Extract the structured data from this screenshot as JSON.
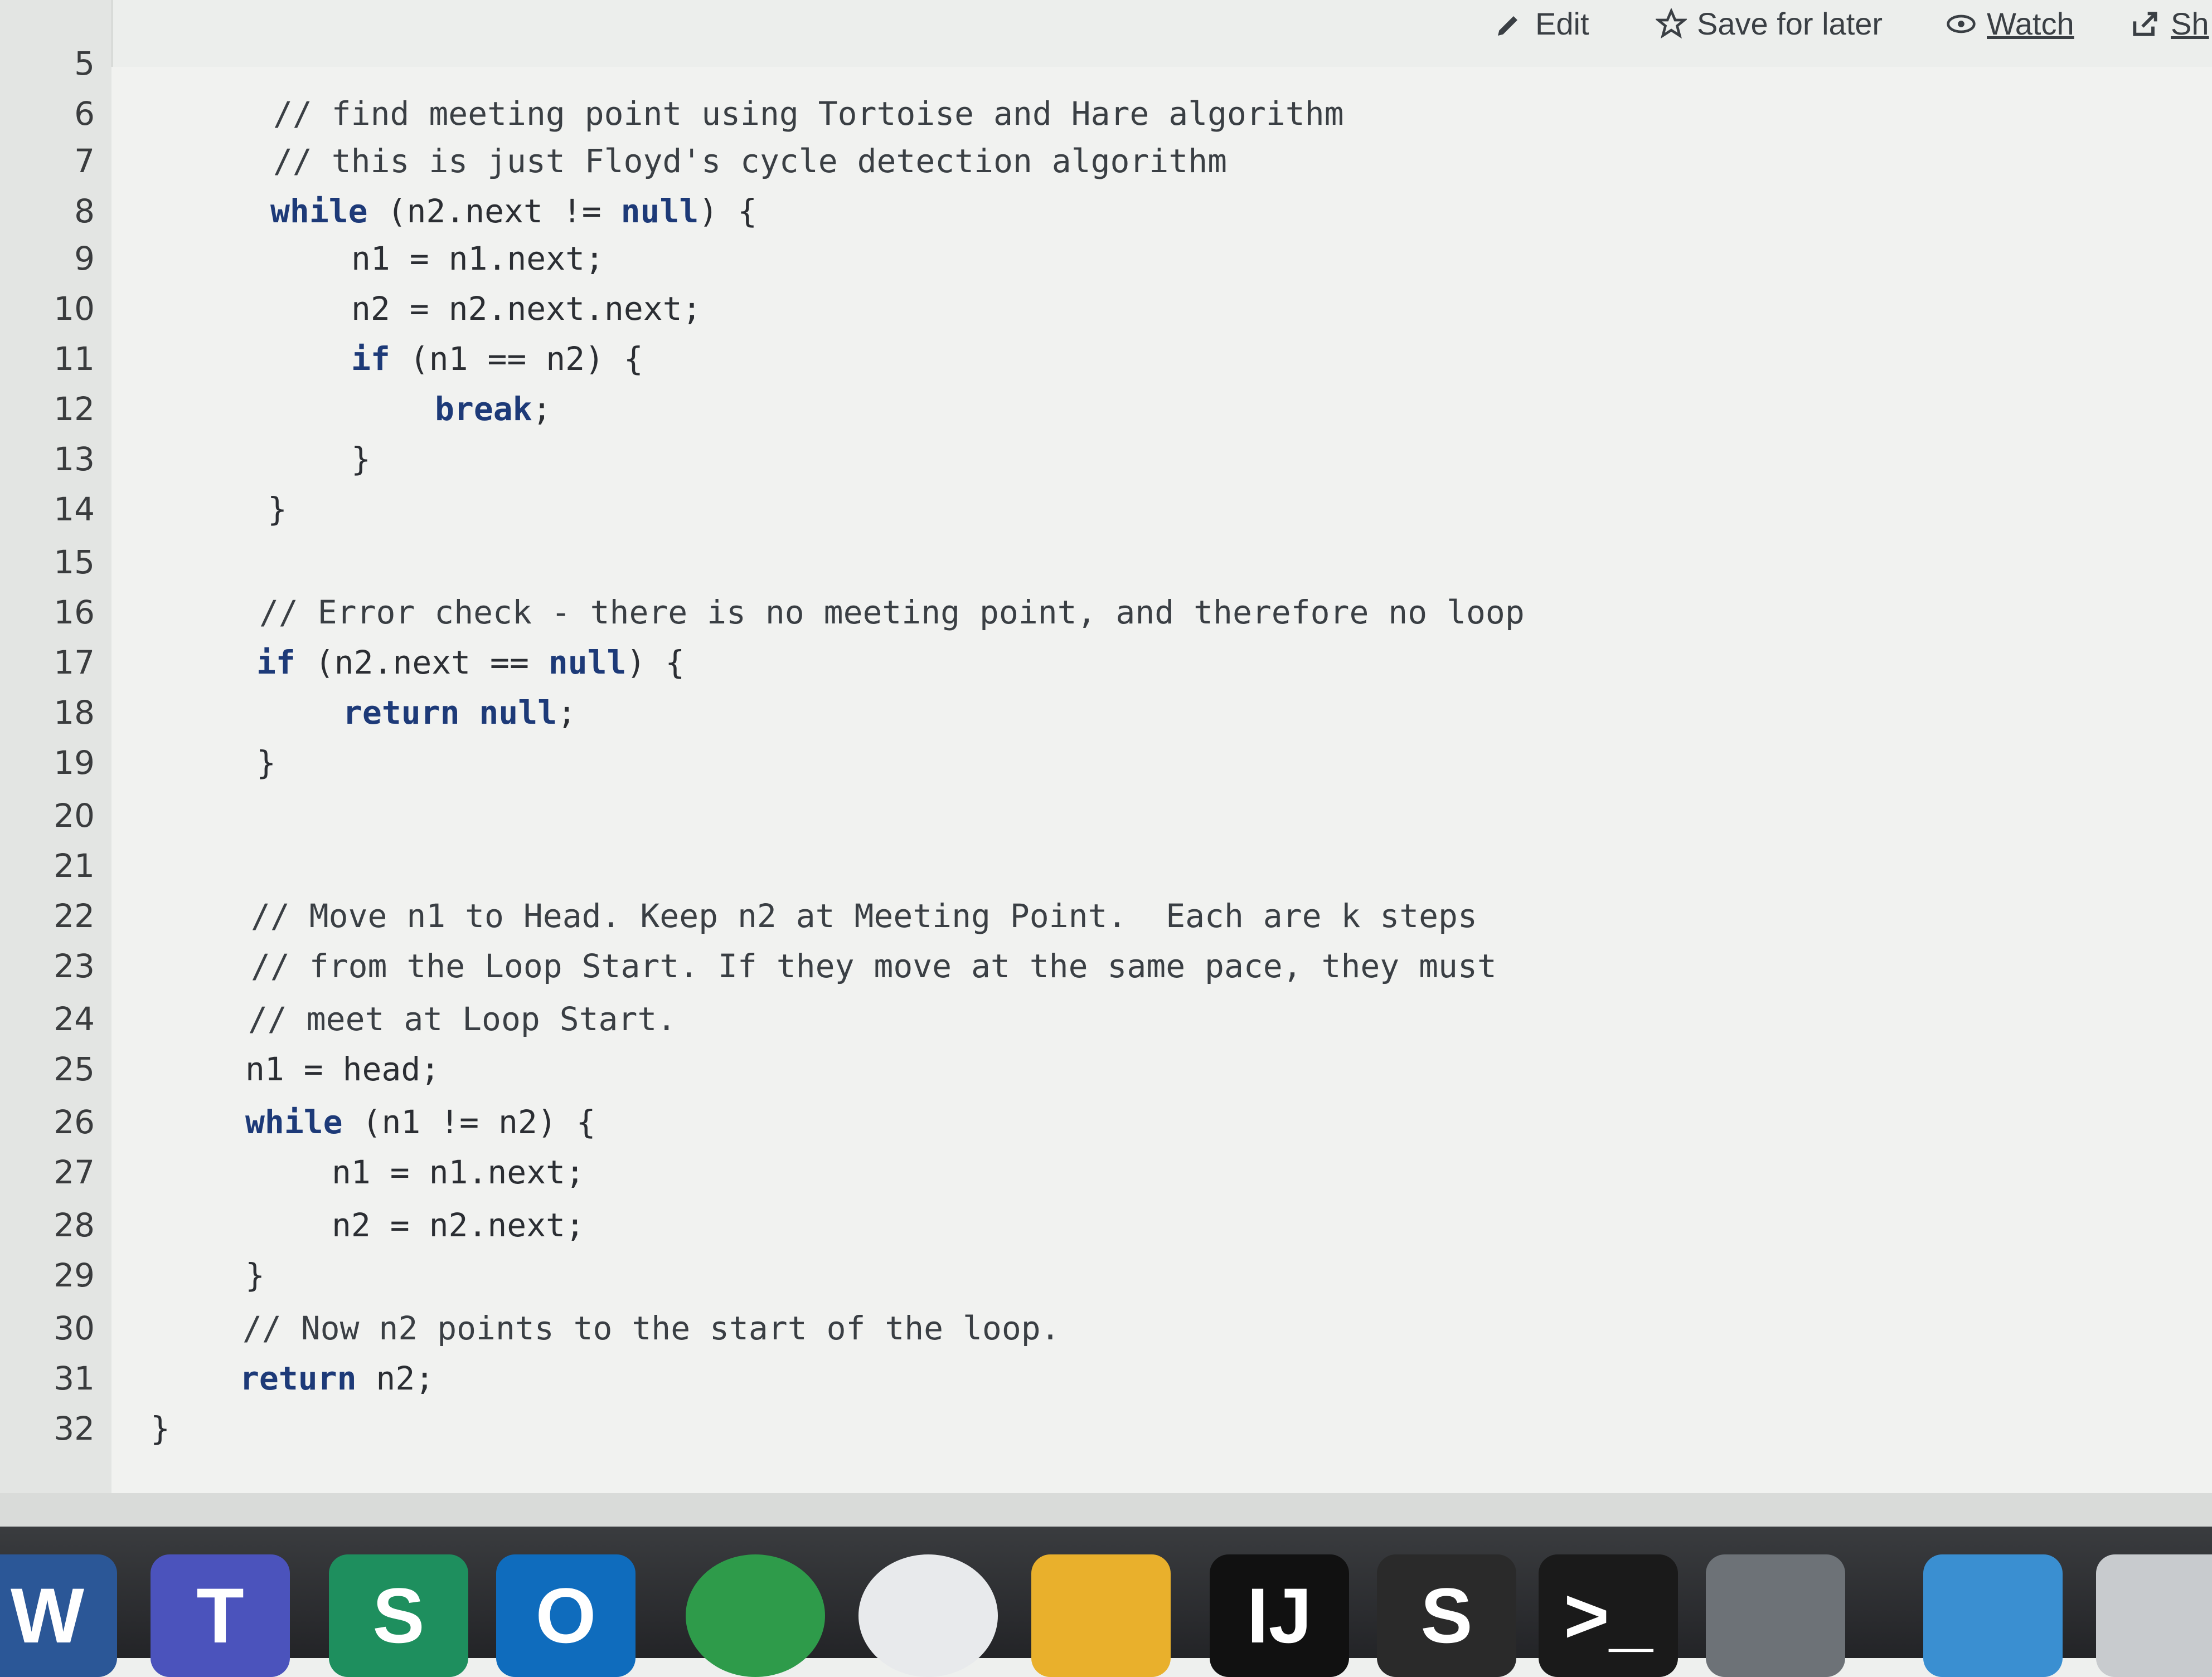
{
  "toolbar": {
    "edit_label": "Edit",
    "save_label": "Save for later",
    "watch_label": "Watch",
    "share_label": "Sh"
  },
  "code": {
    "lines": [
      {
        "n": "5",
        "segments": [
          {
            "t": "",
            "c": "plain"
          }
        ]
      },
      {
        "n": "6",
        "segments": [
          {
            "t": "// find meeting point using Tortoise and Hare algorithm",
            "c": "cm"
          }
        ]
      },
      {
        "n": "7",
        "segments": [
          {
            "t": "// this is just Floyd's cycle detection algorithm",
            "c": "cm"
          }
        ]
      },
      {
        "n": "8",
        "segments": [
          {
            "t": "while",
            "c": "kw"
          },
          {
            "t": " (n2.next != ",
            "c": "plain"
          },
          {
            "t": "null",
            "c": "kw"
          },
          {
            "t": ") {",
            "c": "plain"
          }
        ]
      },
      {
        "n": "9",
        "segments": [
          {
            "t": "n1 = n1.next;",
            "c": "plain"
          }
        ]
      },
      {
        "n": "10",
        "segments": [
          {
            "t": "n2 = n2.next.next;",
            "c": "plain"
          }
        ]
      },
      {
        "n": "11",
        "segments": [
          {
            "t": "if",
            "c": "kw"
          },
          {
            "t": " (n1 == n2) {",
            "c": "plain"
          }
        ]
      },
      {
        "n": "12",
        "segments": [
          {
            "t": "break",
            "c": "kw"
          },
          {
            "t": ";",
            "c": "plain"
          }
        ]
      },
      {
        "n": "13",
        "segments": [
          {
            "t": "}",
            "c": "plain"
          }
        ]
      },
      {
        "n": "14",
        "segments": [
          {
            "t": "}",
            "c": "plain"
          }
        ]
      },
      {
        "n": "15",
        "segments": [
          {
            "t": "",
            "c": "plain"
          }
        ]
      },
      {
        "n": "16",
        "segments": [
          {
            "t": "// Error check - there is no meeting point, and therefore no loop",
            "c": "cm"
          }
        ]
      },
      {
        "n": "17",
        "segments": [
          {
            "t": "if",
            "c": "kw"
          },
          {
            "t": " (n2.next == ",
            "c": "plain"
          },
          {
            "t": "null",
            "c": "kw"
          },
          {
            "t": ") {",
            "c": "plain"
          }
        ]
      },
      {
        "n": "18",
        "segments": [
          {
            "t": "return null",
            "c": "kw"
          },
          {
            "t": ";",
            "c": "plain"
          }
        ]
      },
      {
        "n": "19",
        "segments": [
          {
            "t": "}",
            "c": "plain"
          }
        ]
      },
      {
        "n": "20",
        "segments": [
          {
            "t": "",
            "c": "plain"
          }
        ]
      },
      {
        "n": "21",
        "segments": [
          {
            "t": "",
            "c": "plain"
          }
        ]
      },
      {
        "n": "22",
        "segments": [
          {
            "t": "// Move n1 to Head. Keep n2 at Meeting Point.  Each are k steps",
            "c": "cm"
          }
        ]
      },
      {
        "n": "23",
        "segments": [
          {
            "t": "// from the Loop Start. If they move at the same pace, they must",
            "c": "cm"
          }
        ]
      },
      {
        "n": "24",
        "segments": [
          {
            "t": "// meet at Loop Start.",
            "c": "cm"
          }
        ]
      },
      {
        "n": "25",
        "segments": [
          {
            "t": "n1 = head;",
            "c": "plain"
          }
        ]
      },
      {
        "n": "26",
        "segments": [
          {
            "t": "while",
            "c": "kw"
          },
          {
            "t": " (n1 != n2) {",
            "c": "plain"
          }
        ]
      },
      {
        "n": "27",
        "segments": [
          {
            "t": "n1 = n1.next;",
            "c": "plain"
          }
        ]
      },
      {
        "n": "28",
        "segments": [
          {
            "t": "n2 = n2.next;",
            "c": "plain"
          }
        ]
      },
      {
        "n": "29",
        "segments": [
          {
            "t": "}",
            "c": "plain"
          }
        ]
      },
      {
        "n": "30",
        "segments": [
          {
            "t": "// Now n2 points to the start of the loop.",
            "c": "cm"
          }
        ]
      },
      {
        "n": "31",
        "segments": [
          {
            "t": "return",
            "c": "kw"
          },
          {
            "t": " n2;",
            "c": "plain"
          }
        ]
      },
      {
        "n": "32",
        "segments": [
          {
            "t": "}",
            "c": "plain"
          }
        ]
      }
    ]
  },
  "dock": {
    "apps": [
      {
        "name": "word-app-icon",
        "label": "W",
        "color": "#2b5797"
      },
      {
        "name": "teams-app-icon",
        "label": "T",
        "color": "#4b53bc"
      },
      {
        "name": "sway-app-icon",
        "label": "S",
        "color": "#1e8f5e"
      },
      {
        "name": "outlook-app-icon",
        "label": "O",
        "color": "#0f6cbd"
      },
      {
        "name": "network-app-icon",
        "label": "",
        "color": "#2e9b4a"
      },
      {
        "name": "wifi-app-icon",
        "label": "",
        "color": "#e8eaec"
      },
      {
        "name": "launchpad-app-icon",
        "label": "",
        "color": "#e9b02c"
      },
      {
        "name": "intellij-app-icon",
        "label": "IJ",
        "color": "#111111"
      },
      {
        "name": "sublime-app-icon",
        "label": "S",
        "color": "#2a2a2a"
      },
      {
        "name": "terminal-app-icon",
        "label": ">_",
        "color": "#1a1a1a"
      },
      {
        "name": "system-preferences-app-icon",
        "label": "",
        "color": "#6d7277"
      },
      {
        "name": "downloads-folder-icon",
        "label": "",
        "color": "#3a8fd1"
      },
      {
        "name": "trash-icon",
        "label": "",
        "color": "#c8cbce"
      }
    ]
  }
}
